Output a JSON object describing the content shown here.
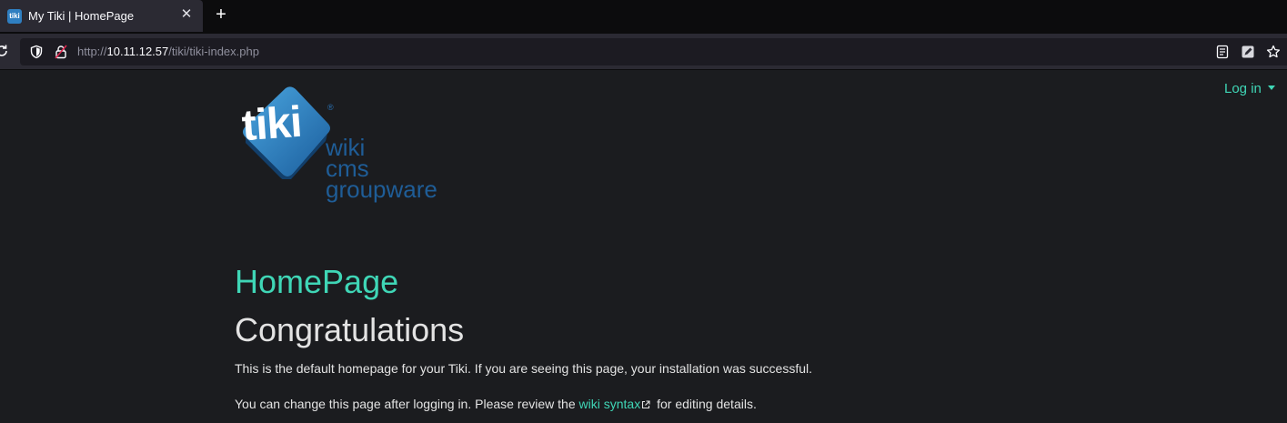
{
  "browser": {
    "tab": {
      "title": "My Tiki | HomePage",
      "favicon_text": "tiki",
      "close_glyph": "✕"
    },
    "new_tab_glyph": "+",
    "url": {
      "scheme": "http://",
      "host": "10.11.12.57",
      "path": "/tiki/tiki-index.php"
    },
    "icons": [
      "reload-icon",
      "shield-icon",
      "lock-icon",
      "reader-view-icon",
      "pen-icon",
      "bookmark-star-icon"
    ]
  },
  "site": {
    "login_label": "Log in",
    "logo": {
      "wordmark": "tiki",
      "registered": "®",
      "tagline": [
        "wiki",
        "cms",
        "groupware"
      ]
    }
  },
  "page": {
    "title": "HomePage",
    "heading": "Congratulations",
    "paragraph1": "This is the default homepage for your Tiki. If you are seeing this page, your installation was successful.",
    "paragraph2_before": "You can change this page after logging in. Please review the ",
    "paragraph2_link": "wiki syntax",
    "paragraph2_after": " for editing details."
  },
  "colors": {
    "accent": "#3fd6b6",
    "page_bg": "#1b1c1f",
    "logo_blue": "#1f5d97"
  }
}
